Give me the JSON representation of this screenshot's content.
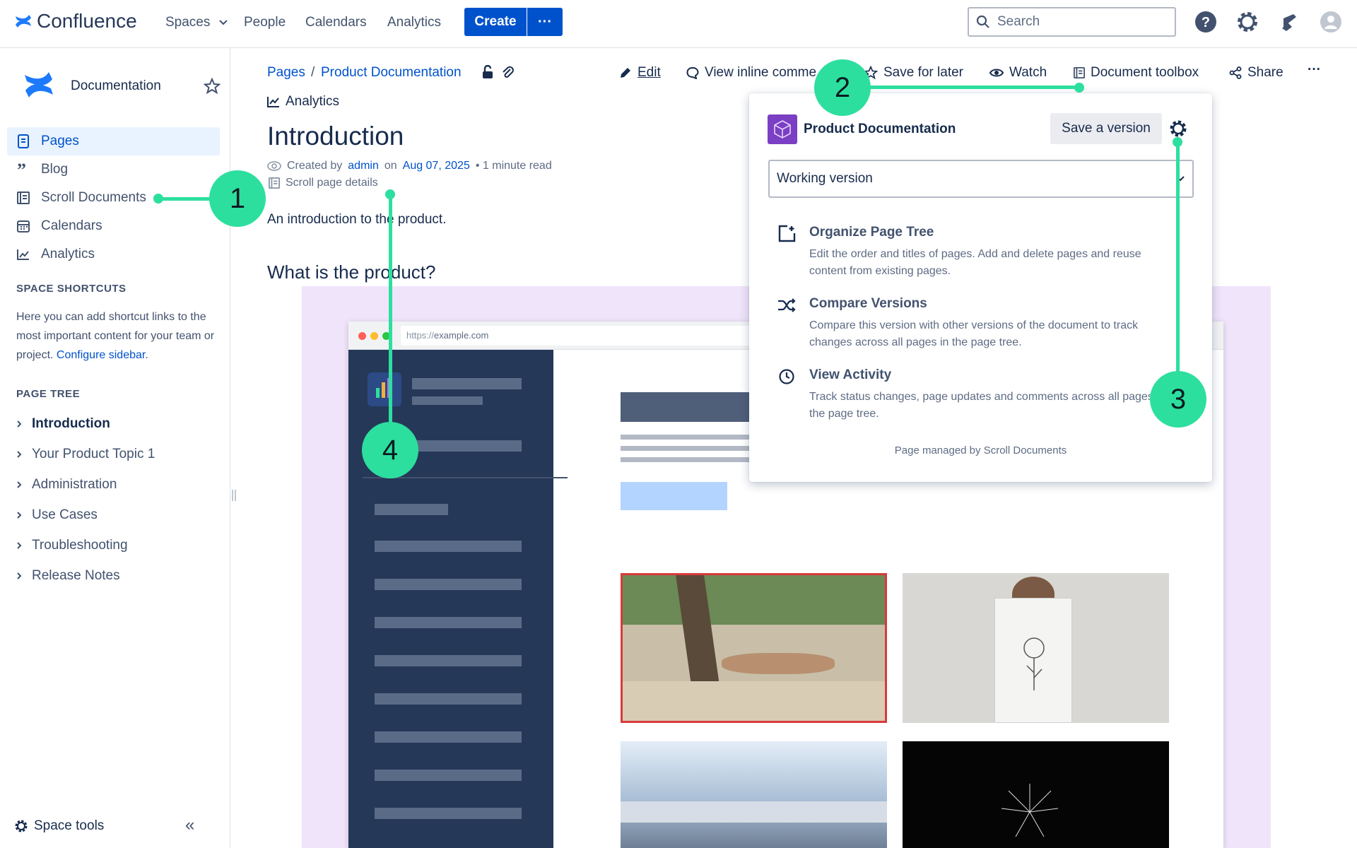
{
  "topnav": {
    "brand": "Confluence",
    "spaces": "Spaces",
    "people": "People",
    "calendars": "Calendars",
    "analytics": "Analytics",
    "create": "Create",
    "more": "···",
    "search_placeholder": "Search"
  },
  "sidebar": {
    "space_name": "Documentation",
    "items": [
      {
        "label": "Pages",
        "icon": "page-icon"
      },
      {
        "label": "Blog",
        "icon": "quote-icon"
      },
      {
        "label": "Scroll Documents",
        "icon": "document-icon"
      },
      {
        "label": "Calendars",
        "icon": "calendar-icon"
      },
      {
        "label": "Analytics",
        "icon": "chart-icon"
      }
    ],
    "shortcuts_heading": "SPACE SHORTCUTS",
    "shortcuts_text": "Here you can add shortcut links to the most important content for your team or project.",
    "configure_link": "Configure sidebar",
    "shortcuts_end": ".",
    "tree_heading": "PAGE TREE",
    "tree": [
      {
        "label": "Introduction"
      },
      {
        "label": "Your Product Topic 1"
      },
      {
        "label": "Administration"
      },
      {
        "label": "Use Cases"
      },
      {
        "label": "Troubleshooting"
      },
      {
        "label": "Release Notes"
      }
    ],
    "space_tools": "Space tools",
    "collapse": "«"
  },
  "breadcrumb": {
    "pages": "Pages",
    "sep": "/",
    "current": "Product Documentation"
  },
  "toolbar": {
    "edit": "Edit",
    "inline_comments": "View inline comme",
    "save_for_later": "Save for later",
    "watch": "Watch",
    "document_toolbox": "Document toolbox",
    "share": "Share",
    "more": "···"
  },
  "page": {
    "analytics": "Analytics",
    "title": "Introduction",
    "created_by": "Created by",
    "author": "admin",
    "on": "on",
    "date": "Aug 07, 2025",
    "read_time": "• 1 minute read",
    "scroll_details": "Scroll page details",
    "intro": "An introduction to the product.",
    "h2": "What is the product?"
  },
  "browser": {
    "url_prefix": "https://",
    "url_domain": "example.com"
  },
  "popup": {
    "title": "Product Documentation",
    "save_version": "Save a version",
    "select_value": "Working version",
    "items": [
      {
        "title": "Organize Page Tree",
        "desc": "Edit the order and titles of pages. Add and delete pages and reuse content from existing pages."
      },
      {
        "title": "Compare Versions",
        "desc": "Compare this version with other versions of the document to track changes across all pages in the page tree."
      },
      {
        "title": "View Activity",
        "desc": "Track status changes, page updates and comments across all pages in the page tree."
      }
    ],
    "footer": "Page managed by Scroll Documents"
  },
  "callouts": [
    "1",
    "2",
    "3",
    "4"
  ],
  "colors": {
    "accent": "#0052cc",
    "callout": "#2ddf9e",
    "sidebar_active": "#e9f2ff"
  }
}
